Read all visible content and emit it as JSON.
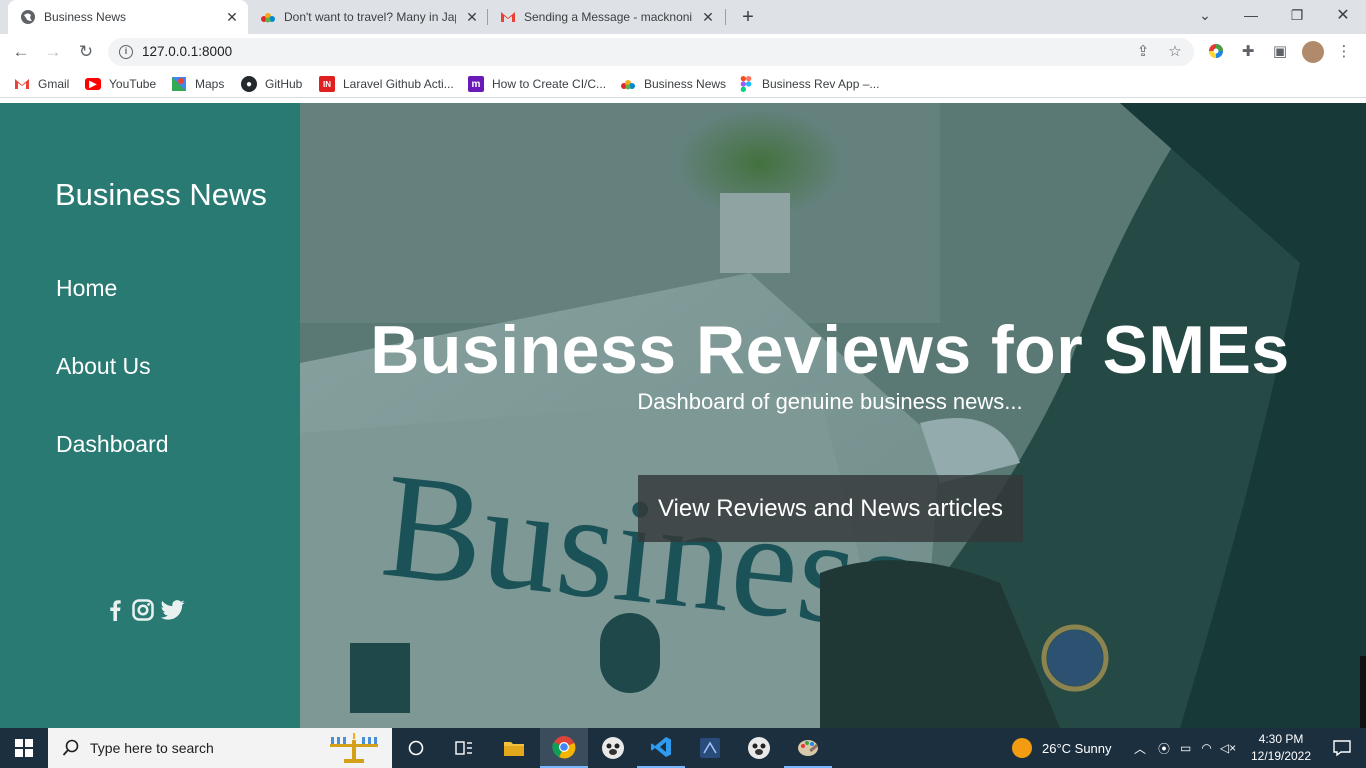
{
  "browser": {
    "tabs": [
      {
        "title": "Business News",
        "active": true
      },
      {
        "title": "Don't want to travel? Many in Jap",
        "active": false
      },
      {
        "title": "Sending a Message - macknonin",
        "active": false
      }
    ],
    "url": "127.0.0.1:8000",
    "bookmarks": [
      {
        "label": "Gmail",
        "icon": "gmail-icon"
      },
      {
        "label": "YouTube",
        "icon": "youtube-icon"
      },
      {
        "label": "Maps",
        "icon": "maps-icon"
      },
      {
        "label": "GitHub",
        "icon": "github-icon"
      },
      {
        "label": "Laravel Github Acti...",
        "icon": "laravel-icon"
      },
      {
        "label": "How to Create CI/C...",
        "icon": "m-icon"
      },
      {
        "label": "Business News",
        "icon": "nbc-icon"
      },
      {
        "label": "Business Rev App –...",
        "icon": "figma-icon"
      }
    ]
  },
  "sidebar": {
    "brand": "Business News",
    "nav": [
      "Home",
      "About Us",
      "Dashboard"
    ],
    "social": [
      "facebook-icon",
      "instagram-icon",
      "twitter-icon"
    ]
  },
  "hero": {
    "title": "Business Reviews for SMEs",
    "subtitle": "Dashboard of genuine business news...",
    "cta_label": "View Reviews and News articles"
  },
  "taskbar": {
    "search_placeholder": "Type here to search",
    "weather": "26°C  Sunny",
    "time": "4:30 PM",
    "date": "12/19/2022"
  },
  "colors": {
    "sidebar_bg": "#297a72",
    "cta_bg": "#343839",
    "taskbar_bg": "#1c2f3f"
  }
}
